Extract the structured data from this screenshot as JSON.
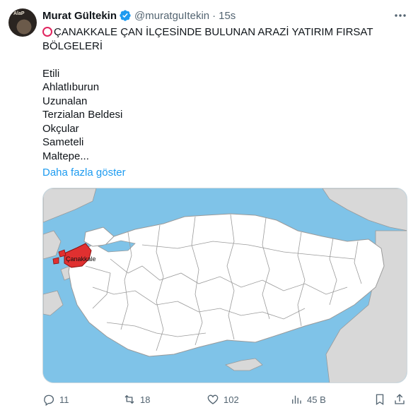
{
  "author": {
    "avatar_text": "AlaP",
    "name": "Murat Gültekin",
    "handle": "@muratguItekin",
    "separator": "·",
    "time": "15s"
  },
  "tweet": {
    "title_line1": "ÇANAKKALE ÇAN İLÇESİNDE BULUNAN ARAZİ YATIRIM FIRSAT",
    "title_line2": "BÖLGELERİ",
    "items": [
      "Etili",
      "Ahlatlıburun",
      "Uzunalan",
      "Terzialan Beldesi",
      "Okçular",
      "Sameteli",
      "Maltepe..."
    ],
    "show_more": "Daha fazla göster"
  },
  "media": {
    "map_label": "Çanakkale",
    "colors": {
      "sea": "#7fc3e8",
      "land": "#ffffff",
      "neighbors": "#d8d8d8",
      "highlight": "#e03030",
      "border": "#9a9a9a"
    }
  },
  "actions": {
    "replies": "11",
    "retweets": "18",
    "likes": "102",
    "views": "45 B"
  }
}
